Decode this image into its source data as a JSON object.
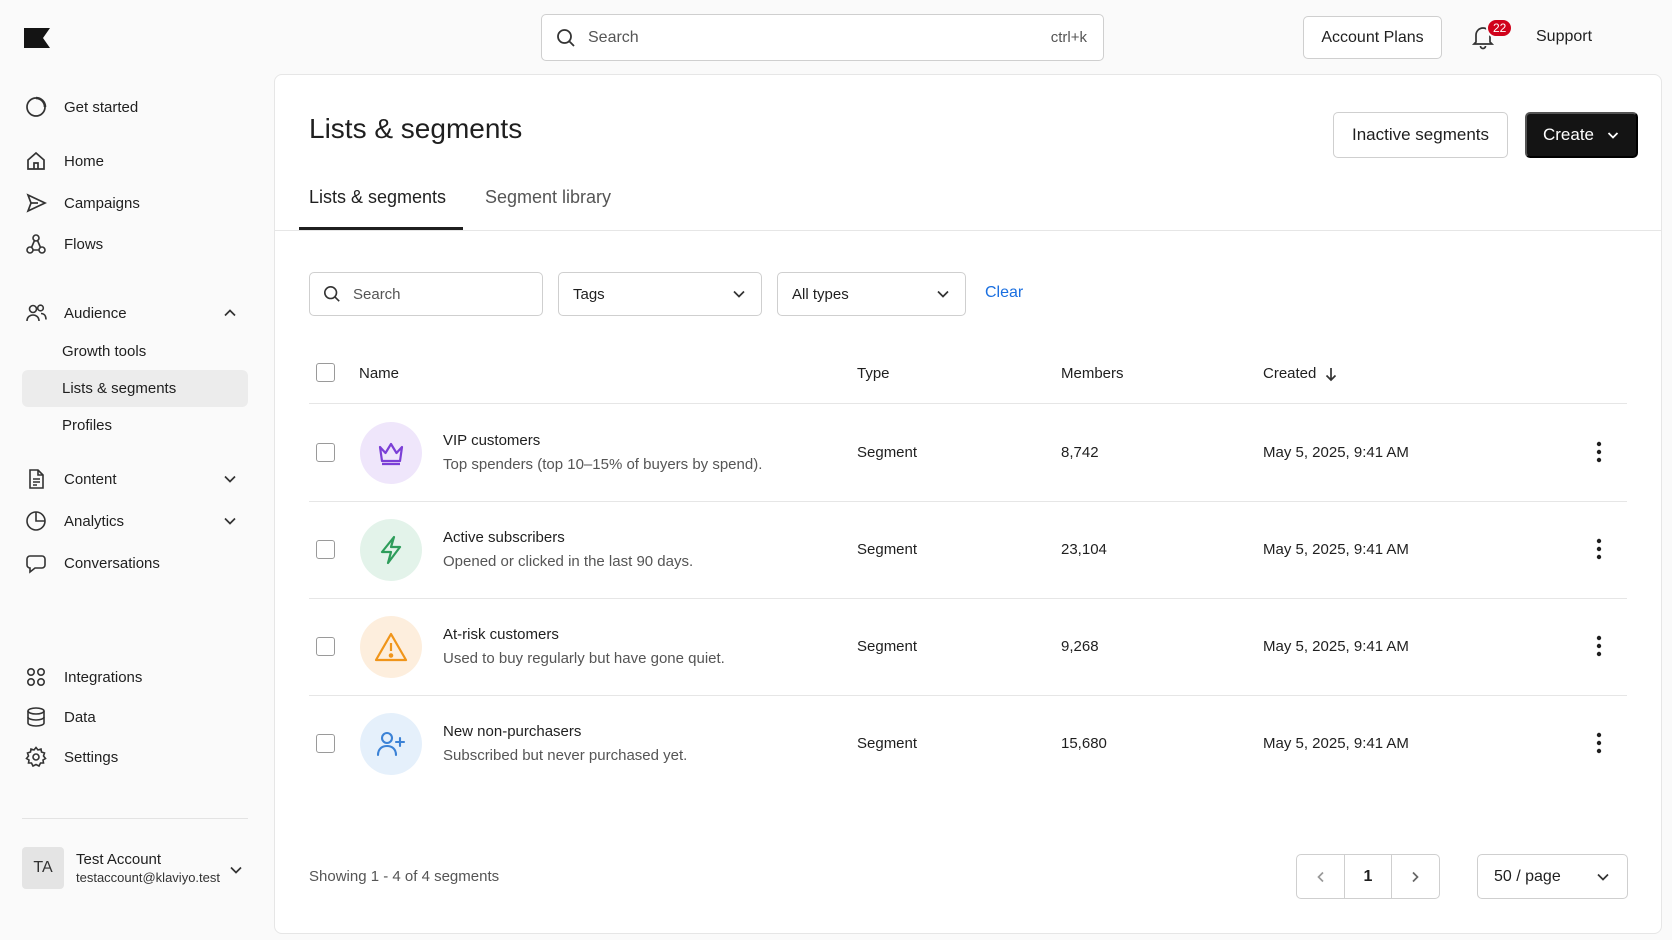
{
  "topbar": {
    "search_placeholder": "Search",
    "search_shortcut": "ctrl+k",
    "account_plans_label": "Account Plans",
    "notification_count": "22",
    "support_label": "Support"
  },
  "sidebar": {
    "get_started": "Get started",
    "home": "Home",
    "campaigns": "Campaigns",
    "flows": "Flows",
    "audience": "Audience",
    "audience_sub": [
      "Growth tools",
      "Lists & segments",
      "Profiles"
    ],
    "content": "Content",
    "analytics": "Analytics",
    "conversations": "Conversations",
    "integrations": "Integrations",
    "data": "Data",
    "settings": "Settings",
    "account": {
      "initials": "TA",
      "name": "Test Account",
      "email": "testaccount@klaviyo.test"
    }
  },
  "page": {
    "title": "Lists & segments",
    "inactive_button": "Inactive segments",
    "create_button": "Create",
    "tabs": [
      "Lists & segments",
      "Segment library"
    ],
    "active_tab": "Lists & segments"
  },
  "filters": {
    "search_placeholder": "Search",
    "tags_label": "Tags",
    "types_label": "All types",
    "clear_label": "Clear"
  },
  "table": {
    "columns": [
      "Name",
      "Type",
      "Members",
      "Created"
    ],
    "sorted_column": "Created",
    "sort_direction": "descending",
    "rows": [
      {
        "name": "VIP customers",
        "description": "Top spenders (top 10–15% of buyers by spend).",
        "type": "Segment",
        "members": "8,742",
        "created": "May 5, 2025, 9:41 AM",
        "icon": "crown-icon",
        "icon_bg": "#efe6fb",
        "icon_color": "#7b3fd6"
      },
      {
        "name": "Active subscribers",
        "description": "Opened or clicked in the last 90 days.",
        "type": "Segment",
        "members": "23,104",
        "created": "May 5, 2025, 9:41 AM",
        "icon": "lightning-icon",
        "icon_bg": "#e3f3ea",
        "icon_color": "#2e9d5b"
      },
      {
        "name": "At-risk customers",
        "description": "Used to buy regularly but have gone quiet.",
        "type": "Segment",
        "members": "9,268",
        "created": "May 5, 2025, 9:41 AM",
        "icon": "warning-icon",
        "icon_bg": "#fdeedd",
        "icon_color": "#f0951a"
      },
      {
        "name": "New non-purchasers",
        "description": "Subscribed but never purchased yet.",
        "type": "Segment",
        "members": "15,680",
        "created": "May 5, 2025, 9:41 AM",
        "icon": "add-user-icon",
        "icon_bg": "#e5f0fb",
        "icon_color": "#3b82d6"
      }
    ]
  },
  "footer": {
    "showing_text": "Showing 1 - 4 of 4 segments",
    "current_page": "1",
    "per_page": "50 / page"
  },
  "colors": {
    "accent_link": "#1a6fe0",
    "primary_button": "#141414",
    "badge": "#d0021b"
  }
}
